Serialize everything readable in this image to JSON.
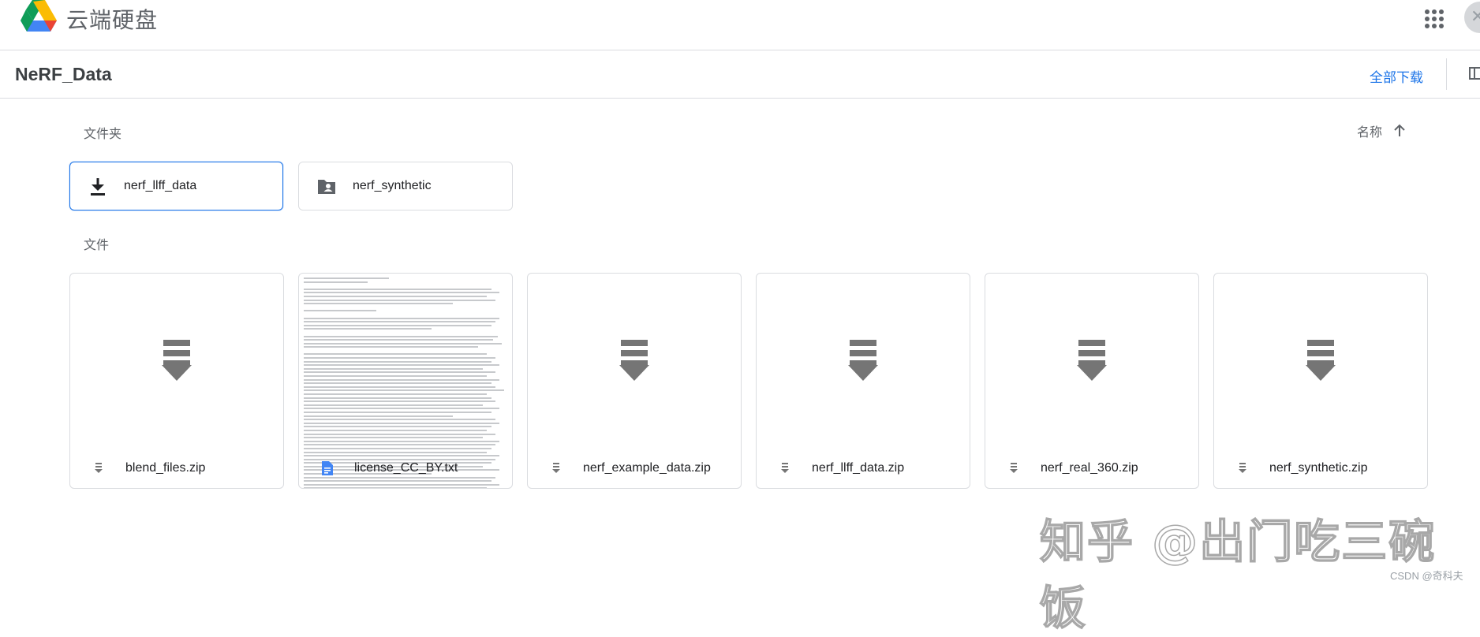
{
  "app": {
    "name": "云端硬盘"
  },
  "header": {
    "title": "NeRF_Data",
    "download_all": "全部下载"
  },
  "sections": {
    "folders_label": "文件夹",
    "files_label": "文件"
  },
  "sort": {
    "label": "名称",
    "direction": "ascending"
  },
  "folders": [
    {
      "name": "nerf_llff_data",
      "icon": "download-icon",
      "selected": true
    },
    {
      "name": "nerf_synthetic",
      "icon": "shared-folder-icon",
      "selected": false
    }
  ],
  "files": [
    {
      "name": "blend_files.zip",
      "type": "zip",
      "icon": "zip-icon"
    },
    {
      "name": "license_CC_BY.txt",
      "type": "txt",
      "icon": "doc-icon"
    },
    {
      "name": "nerf_example_data.zip",
      "type": "zip",
      "icon": "zip-icon"
    },
    {
      "name": "nerf_llff_data.zip",
      "type": "zip",
      "icon": "zip-icon"
    },
    {
      "name": "nerf_real_360.zip",
      "type": "zip",
      "icon": "zip-icon"
    },
    {
      "name": "nerf_synthetic.zip",
      "type": "zip",
      "icon": "zip-icon"
    }
  ],
  "watermark": {
    "text": "知乎 @出门吃三碗饭",
    "csdn": "CSDN @奇科夫"
  },
  "colors": {
    "accent": "#1a73e8",
    "icon_gray": "#5f6368",
    "zip_gray": "#757575",
    "doc_blue": "#4285f4",
    "border": "#dadce0"
  }
}
